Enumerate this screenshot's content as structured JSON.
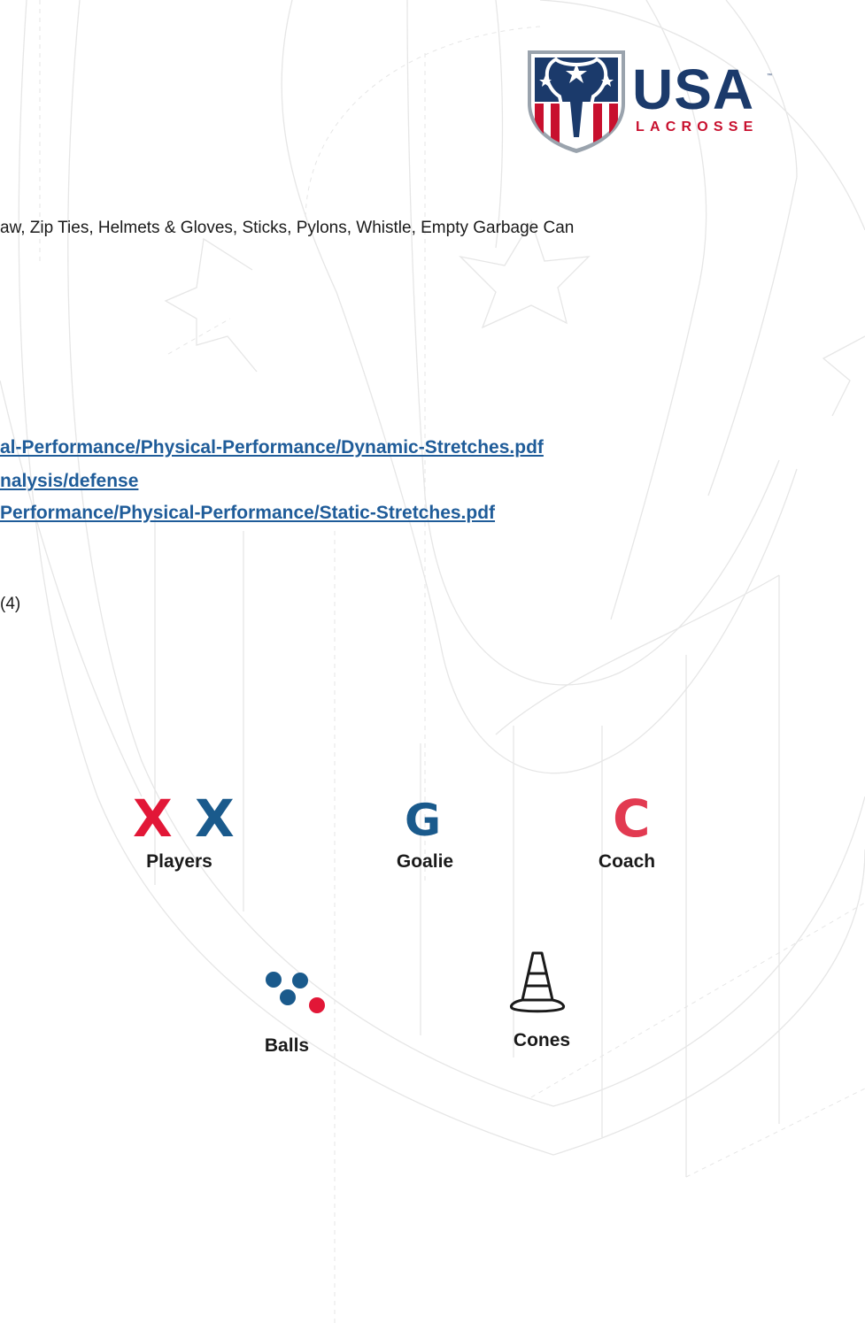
{
  "logo": {
    "wordmark": "USA",
    "subtext": "LACROSSE",
    "trademark": "™"
  },
  "equipment_text": "aw, Zip Ties, Helmets & Gloves, Sticks, Pylons, Whistle, Empty Garbage Can",
  "links": [
    "al-Performance/Physical-Performance/Dynamic-Stretches.pdf",
    "nalysis/defense",
    "Performance/Physical-Performance/Static-Stretches.pdf"
  ],
  "count_text": "(4)",
  "legend": {
    "players": {
      "label": "Players",
      "symbol_1": "X",
      "symbol_2": "X"
    },
    "goalie": {
      "label": "Goalie",
      "symbol": "G"
    },
    "coach": {
      "label": "Coach",
      "symbol": "C"
    },
    "balls": {
      "label": "Balls"
    },
    "cones": {
      "label": "Cones"
    }
  },
  "colors": {
    "navy": "#1b3a6b",
    "red": "#c8102e",
    "player_red": "#e21737",
    "blue": "#1a5a8c",
    "coach_red": "#e23a51",
    "link_blue": "#1f5c99"
  }
}
